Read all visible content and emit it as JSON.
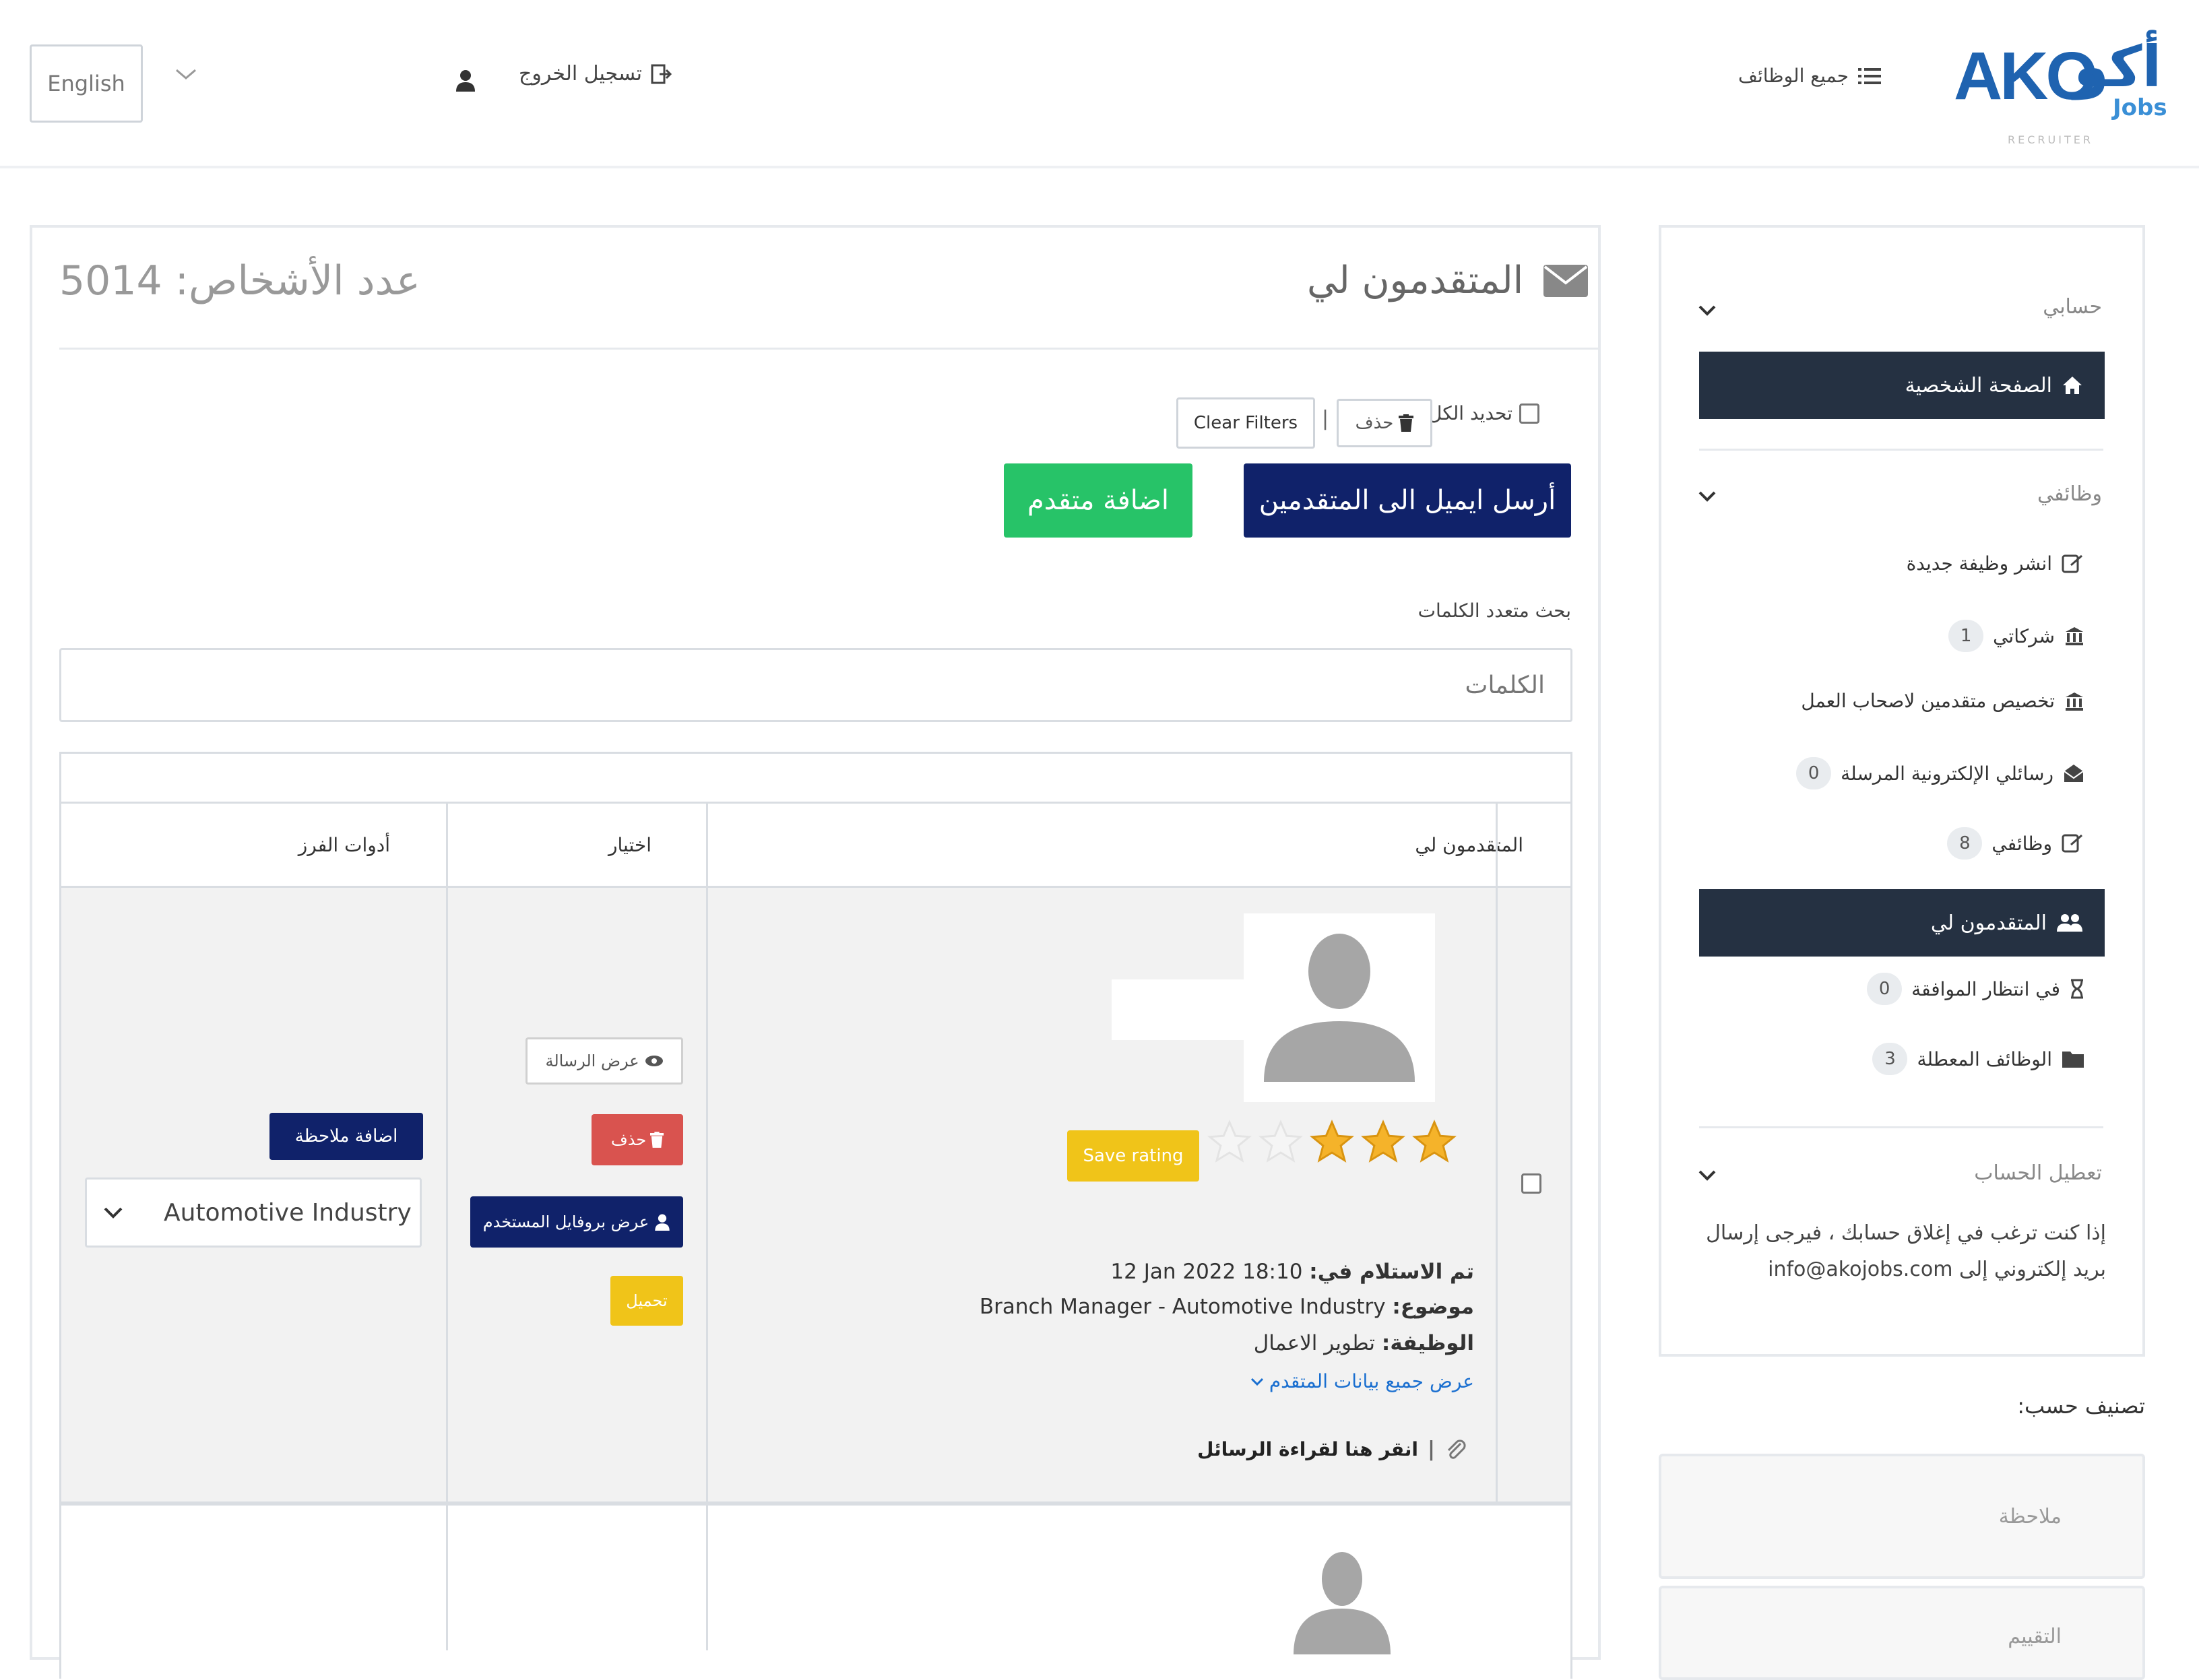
{
  "header": {
    "language": "English",
    "logout": "تسجيل الخروج",
    "all_jobs": "جميع الوظائف",
    "logo": {
      "word": "AKO",
      "arabic": "أكو",
      "jobs": "Jobs",
      "tagline": "RECRUITER"
    }
  },
  "main": {
    "title": "المتقدمون لي",
    "count_label": "عدد الأشخاص:",
    "count_value": "5014",
    "select_all": "تحديد الكل",
    "delete": "حذف",
    "clear_filters": "Clear Filters",
    "send_email": "أرسل ايميل الى المتقدمين",
    "add_applicant": "اضافة متقدم",
    "search_label": "بحث متعدد الكلمات",
    "search_placeholder": "الكلمات"
  },
  "table": {
    "headers": {
      "applicants": "المتقدمون لي",
      "options": "اختيار",
      "sort_tools": "أدوات الفرز"
    },
    "rows": [
      {
        "rating": 3,
        "rating_max": 5,
        "save_rating": "Save rating",
        "received_label": "تم الاستلام في:",
        "received_value": "12 Jan 2022 18:10",
        "subject_label": "موضوع:",
        "subject_value": "Branch Manager - Automotive Industry",
        "job_label": "الوظيفة:",
        "job_value": "تطوير الاعمال",
        "show_all": "عرض جميع بيانات المتقدم",
        "read_messages": "انقر هنا لقراءة الرسائل",
        "view_message": "عرض الرسالة",
        "delete": "حذف",
        "view_profile": "عرض بروفايل المستخدم",
        "download": "تحميل",
        "add_note": "اضافة ملاحظة",
        "industry": "Automotive Industry"
      }
    ]
  },
  "sidebar": {
    "account_section": "حسابي",
    "home": "الصفحة الشخصية",
    "jobs_section": "وظائفي",
    "items": [
      {
        "label": "انشر وظيفة جديدة",
        "badge": ""
      },
      {
        "label": "شركاتي",
        "badge": "1"
      },
      {
        "label": "تخصيص متقدمين لاصحاب العمل",
        "badge": ""
      },
      {
        "label": "رسائلي الإلكترونية المرسلة",
        "badge": "0"
      },
      {
        "label": "وظائفي",
        "badge": "8"
      }
    ],
    "active_item": "المتقدمون لي",
    "sub_items": [
      {
        "label": "في انتظار الموافقة",
        "badge": "0"
      },
      {
        "label": "الوظائف المعطلة",
        "badge": "3"
      }
    ],
    "deactivate_section": "تعطيل الحساب",
    "deactivate_text_1": "إذا كنت ترغب في إغلاق حسابك ، فيرجى إرسال",
    "deactivate_text_2": "بريد إلكتروني إلى info@akojobs.com",
    "sort_label": "تصنيف حسب:",
    "sort_note": "ملاحظة",
    "sort_rating": "التقييم"
  },
  "colors": {
    "navy": "#10226a",
    "green": "#27c368",
    "sidebar_dark": "#253142",
    "star": "#f5b32a",
    "yellow": "#f0c419",
    "red": "#d9534f",
    "logo_blue": "#1f63b0"
  }
}
